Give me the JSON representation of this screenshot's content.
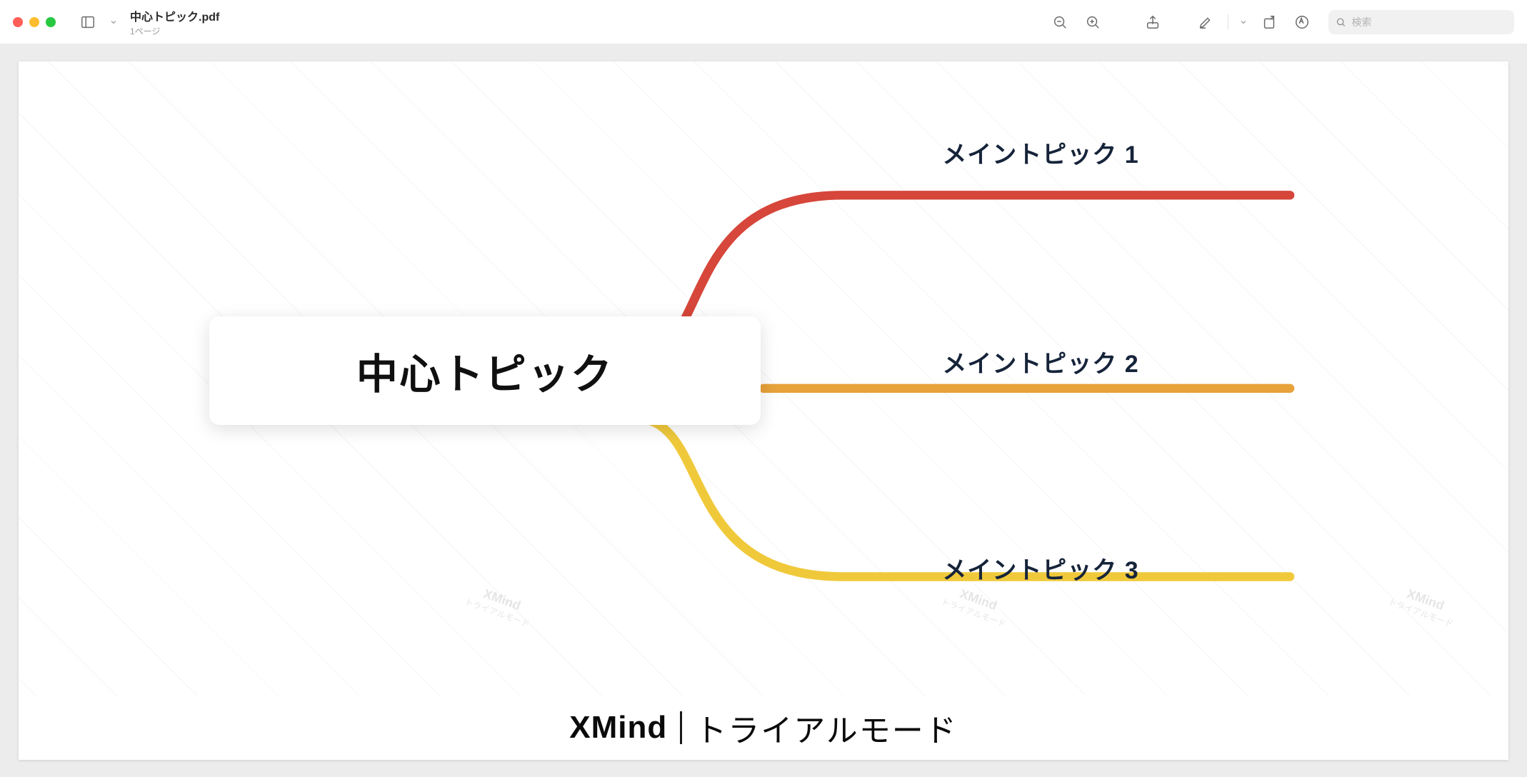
{
  "window": {
    "title": "中心トピック.pdf",
    "subtitle": "1ページ"
  },
  "search": {
    "placeholder": "検索"
  },
  "mindmap": {
    "central": "中心トピック",
    "topics": [
      {
        "label": "メイントピック 1",
        "color": "#d6463a"
      },
      {
        "label": "メイントピック 2",
        "color": "#e7a23a"
      },
      {
        "label": "メイントピック 3",
        "color": "#f0c93b"
      }
    ]
  },
  "footer": {
    "brand": "XMind",
    "mode": "トライアルモード"
  },
  "watermark": {
    "brand": "XMind",
    "sub": "トライアルモード"
  },
  "icons": {
    "sidebar": "sidebar-icon",
    "zoom_out": "zoom-out-icon",
    "zoom_in": "zoom-in-icon",
    "share": "share-icon",
    "annotate": "pencil-icon",
    "rotate": "rotate-icon",
    "highlight": "marker-icon",
    "search": "search-icon"
  }
}
